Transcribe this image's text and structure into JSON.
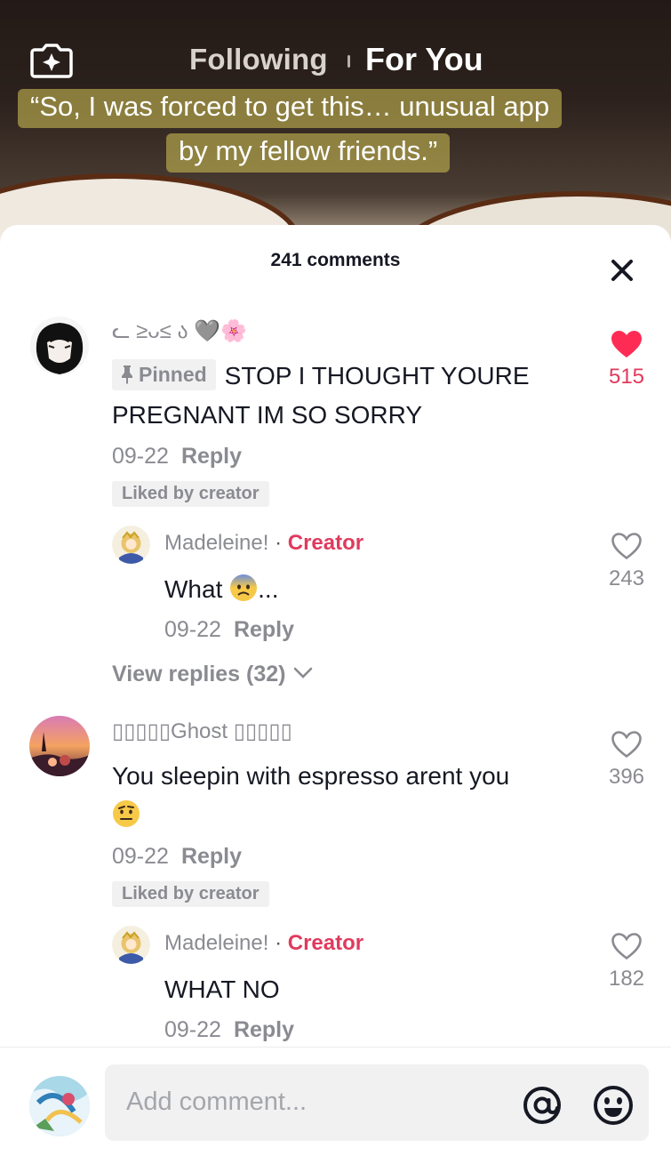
{
  "nav": {
    "following": "Following",
    "for_you": "For You"
  },
  "video": {
    "caption_line1": "“So, I was forced to get this… unusual app",
    "caption_line2": "by my fellow friends.”"
  },
  "sheet": {
    "title": "241 comments"
  },
  "comments": [
    {
      "username": "ᓚ ≥ᴗ≤ ა 🩶🌸",
      "pinned_label": "Pinned",
      "text": "STOP I THOUGHT YOURE PREGNANT IM SO SORRY",
      "date": "09-22",
      "reply_label": "Reply",
      "liked_badge": "Liked by creator",
      "likes": "515",
      "liked": true,
      "reply": {
        "username": "Madeleine!",
        "dot": " · ",
        "creator_tag": "Creator",
        "text": "What",
        "text_suffix": "...",
        "date": "09-22",
        "reply_label": "Reply",
        "likes": "243"
      },
      "view_replies": "View replies (32)"
    },
    {
      "username": "▯▯▯▯▯Ghost ▯▯▯▯▯",
      "text": "You sleepin with espresso arent you",
      "date": "09-22",
      "reply_label": "Reply",
      "liked_badge": "Liked by creator",
      "likes": "396",
      "reply": {
        "username": "Madeleine!",
        "dot": " · ",
        "creator_tag": "Creator",
        "text": "WHAT NO",
        "date": "09-22",
        "reply_label": "Reply",
        "likes": "182"
      }
    }
  ],
  "input": {
    "placeholder": "Add comment..."
  },
  "colors": {
    "accent": "#e03a5d",
    "like_red": "#fe2c55",
    "muted": "#8a8b91"
  }
}
